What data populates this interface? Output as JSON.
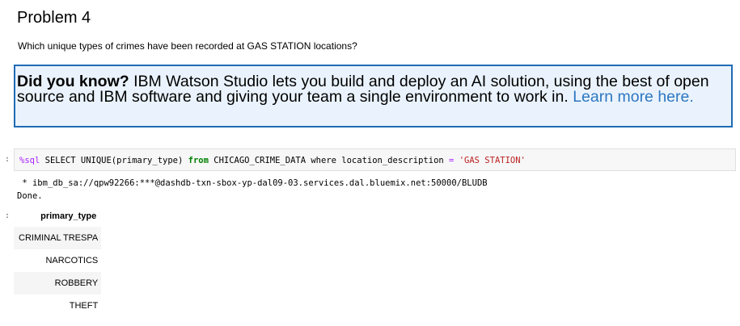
{
  "heading": "Problem 4",
  "question": "Which unique types of crimes have been recorded at GAS STATION locations?",
  "callout": {
    "bold": "Did you know?",
    "text": " IBM Watson Studio lets you build and deploy an AI solution, using the best of open source and IBM software and giving your team a single environment to work in. ",
    "link": "Learn more here."
  },
  "code_cell": {
    "prompt": ":",
    "magic": "%sql",
    "part1": " SELECT UNIQUE(primary_type) ",
    "from": "from",
    "part2": " CHICAGO_CRIME_DATA where location_description ",
    "equals": "=",
    "space": " ",
    "string": "'GAS STATION'"
  },
  "output": {
    "connection": " * ibm_db_sa://qpw92266:***@dashdb-txn-sbox-yp-dal09-03.services.dal.bluemix.net:50000/BLUDB",
    "done": "Done.",
    "prompt": ":"
  },
  "result_table": {
    "header": "primary_type",
    "rows": [
      "CRIMINAL TRESPA",
      "NARCOTICS",
      "ROBBERY",
      "THEFT"
    ]
  }
}
